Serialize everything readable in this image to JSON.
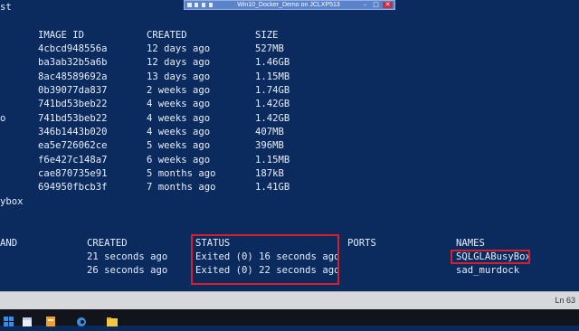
{
  "window": {
    "title": "Win10_Docker_Demo on JCLXP513"
  },
  "terminal": {
    "left_fragments": [
      "st",
      "o",
      "ybox"
    ],
    "images": {
      "headers": {
        "image_id": "IMAGE ID",
        "created": "CREATED",
        "size": "SIZE"
      },
      "rows": [
        {
          "image_id": "4cbcd948556a",
          "created": "12 days ago",
          "size": "527MB"
        },
        {
          "image_id": "ba3ab32b5a6b",
          "created": "12 days ago",
          "size": "1.46GB"
        },
        {
          "image_id": "8ac48589692a",
          "created": "13 days ago",
          "size": "1.15MB"
        },
        {
          "image_id": "0b39077da837",
          "created": "2 weeks ago",
          "size": "1.74GB"
        },
        {
          "image_id": "741bd53beb22",
          "created": "4 weeks ago",
          "size": "1.42GB"
        },
        {
          "image_id": "741bd53beb22",
          "created": "4 weeks ago",
          "size": "1.42GB"
        },
        {
          "image_id": "346b1443b020",
          "created": "4 weeks ago",
          "size": "407MB"
        },
        {
          "image_id": "ea5e726062ce",
          "created": "5 weeks ago",
          "size": "396MB"
        },
        {
          "image_id": "f6e427c148a7",
          "created": "6 weeks ago",
          "size": "1.15MB"
        },
        {
          "image_id": "cae870735e91",
          "created": "5 months ago",
          "size": "187kB"
        },
        {
          "image_id": "694950fbcb3f",
          "created": "7 months ago",
          "size": "1.41GB"
        }
      ]
    },
    "containers": {
      "headers": {
        "command_tail": "AND",
        "created": "CREATED",
        "status": "STATUS",
        "ports": "PORTS",
        "names": "NAMES"
      },
      "rows": [
        {
          "created": "21 seconds ago",
          "status": "Exited (0) 16 seconds ago",
          "name": "SQLGLABusyBox"
        },
        {
          "created": "26 seconds ago",
          "status": "Exited (0) 22 seconds ago",
          "name": "sad_murdock"
        }
      ]
    },
    "highlight_color": "#d51f2a"
  },
  "statusbar": {
    "line_indicator": "Ln 63"
  },
  "taskbar": {
    "icons": [
      "windows-start-icon",
      "explorer-icon",
      "powershell-icon",
      "edge-icon",
      "folder-icon"
    ]
  }
}
